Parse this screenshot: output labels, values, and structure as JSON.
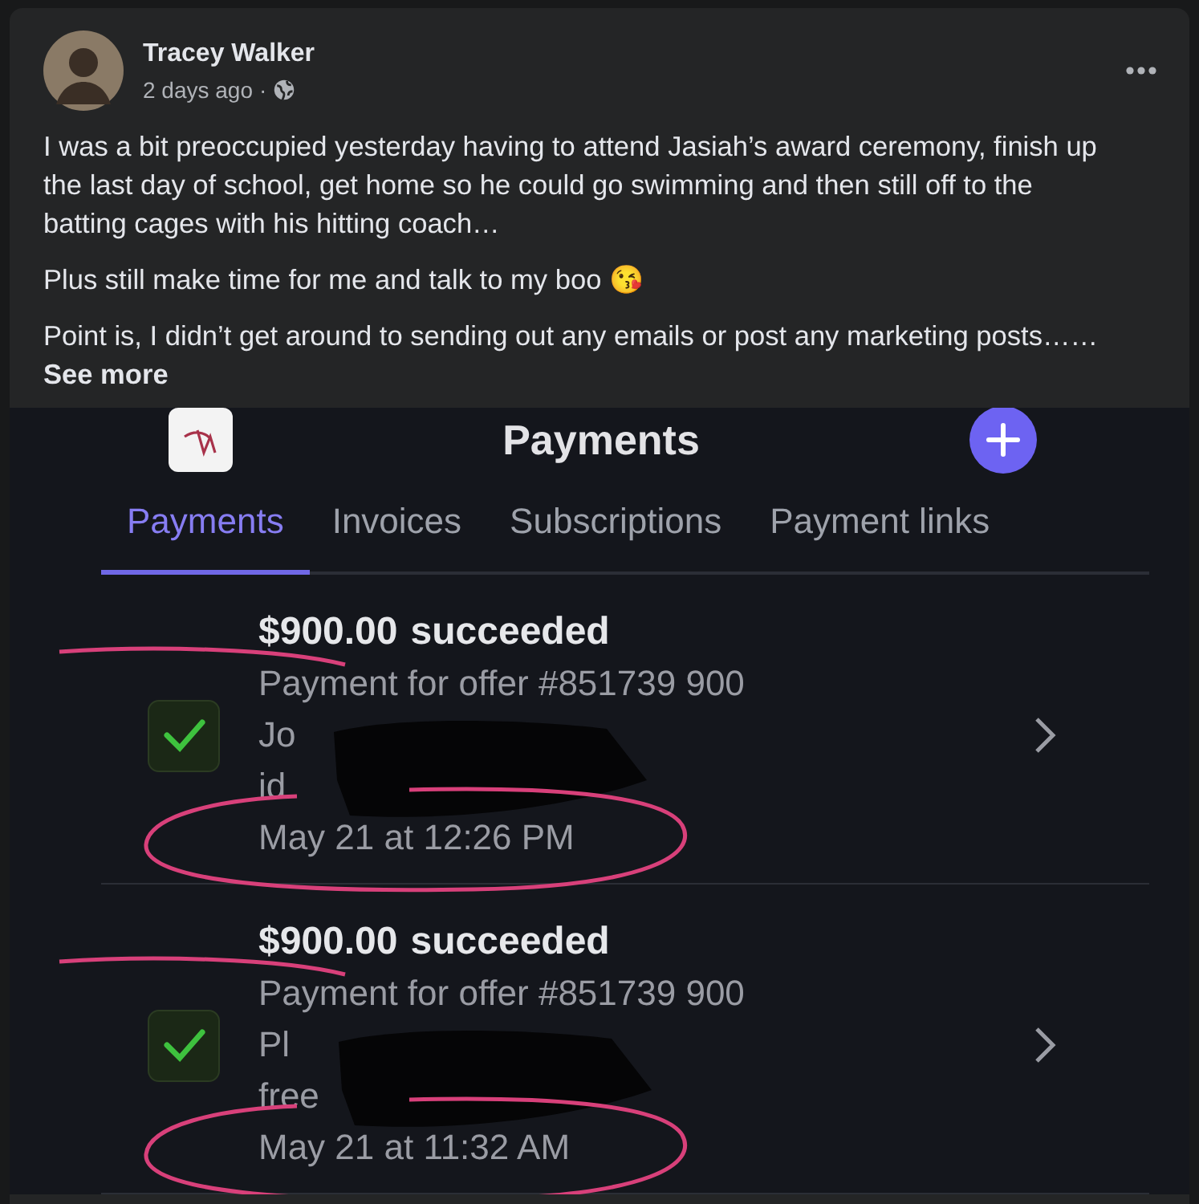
{
  "post": {
    "author": "Tracey Walker",
    "time": "2 days ago",
    "separator": "·",
    "paragraphs": [
      "I was a bit preoccupied yesterday having to attend Jasiah’s award ceremony, finish up the last day of school, get home so he could go swimming and then still off to the batting cages with his hitting coach…",
      "Plus still make time for me and talk to my boo 😘",
      "Point is, I didn’t get around to sending out any emails or post any marketing posts……"
    ],
    "see_more": "See more"
  },
  "attachment": {
    "kind": "screenshot",
    "title": "Payments",
    "tabs": [
      {
        "label": "Payments",
        "selected": true
      },
      {
        "label": "Invoices",
        "selected": false
      },
      {
        "label": "Subscriptions",
        "selected": false
      },
      {
        "label": "Payment links",
        "selected": false
      }
    ],
    "payments": [
      {
        "amount": "$900.00",
        "status": "succeeded",
        "succeeded": true,
        "description": "Payment for offer #851739 900",
        "name_fragment": "Jo",
        "email_fragment": "id",
        "date": "May 21 at 12:26 PM"
      },
      {
        "amount": "$900.00",
        "status": "succeeded",
        "succeeded": true,
        "description": "Payment for offer #851739 900",
        "name_fragment": "Pl",
        "email_fragment": "free",
        "date": "May 21 at 11:32 AM"
      }
    ]
  }
}
